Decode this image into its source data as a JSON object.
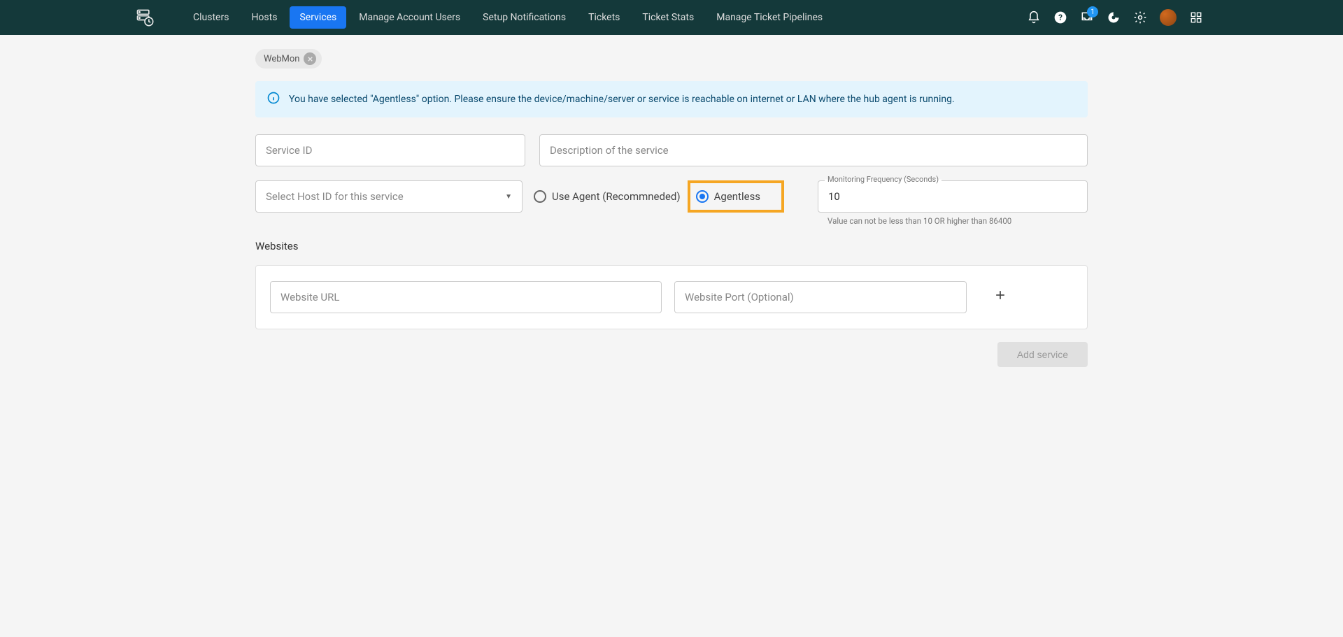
{
  "nav": {
    "items": [
      {
        "label": "Clusters"
      },
      {
        "label": "Hosts"
      },
      {
        "label": "Services"
      },
      {
        "label": "Manage Account Users"
      },
      {
        "label": "Setup Notifications"
      },
      {
        "label": "Tickets"
      },
      {
        "label": "Ticket Stats"
      },
      {
        "label": "Manage Ticket Pipelines"
      }
    ],
    "inbox_badge": "1"
  },
  "chip": {
    "label": "WebMon"
  },
  "alert": {
    "text": "You have selected \"Agentless\" option. Please ensure the device/machine/server or service is reachable on internet or LAN where the hub agent is running."
  },
  "form": {
    "service_id_placeholder": "Service ID",
    "description_placeholder": "Description of the service",
    "host_select_placeholder": "Select Host ID for this service",
    "radio_use_agent_label": "Use Agent (Recommneded)",
    "radio_agentless_label": "Agentless",
    "freq_label": "Monitoring Frequency (Seconds)",
    "freq_value": "10",
    "freq_helper": "Value can not be less than 10 OR higher than 86400"
  },
  "websites": {
    "section_title": "Websites",
    "url_placeholder": "Website URL",
    "port_placeholder": "Website Port (Optional)"
  },
  "submit": {
    "label": "Add service"
  }
}
